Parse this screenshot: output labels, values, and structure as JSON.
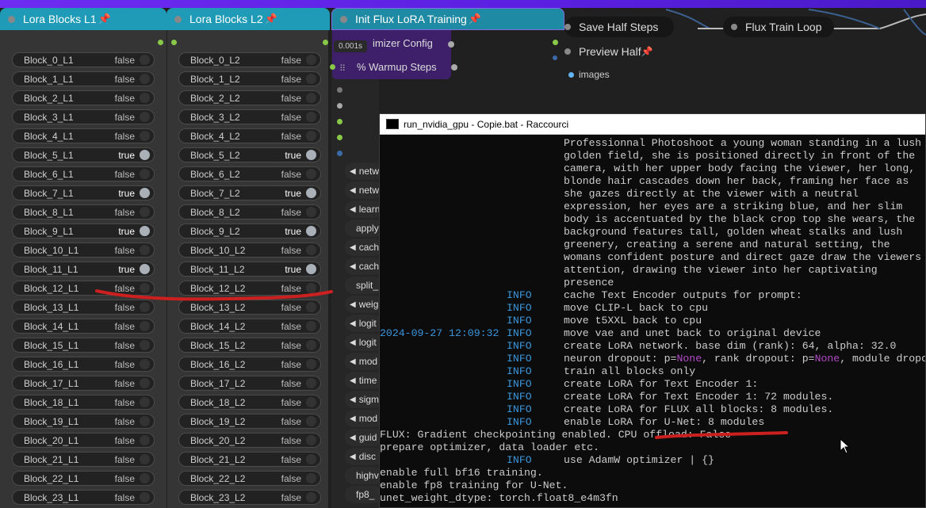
{
  "nodes": {
    "lora_l1": {
      "title": "Lora Blocks L1"
    },
    "lora_l2": {
      "title": "Lora Blocks L2"
    },
    "init_flux": {
      "title": "Init Flux LoRA Training",
      "timing": "0.001s"
    },
    "save_half": {
      "title": "Save Half Steps"
    },
    "flux_loop": {
      "title": "Flux Train Loop"
    },
    "preview_half": {
      "title": "Preview Half"
    },
    "images_output": {
      "label": "images"
    }
  },
  "blocks_l1": [
    {
      "label": "Block_0_L1",
      "value": "false"
    },
    {
      "label": "Block_1_L1",
      "value": "false"
    },
    {
      "label": "Block_2_L1",
      "value": "false"
    },
    {
      "label": "Block_3_L1",
      "value": "false"
    },
    {
      "label": "Block_4_L1",
      "value": "false"
    },
    {
      "label": "Block_5_L1",
      "value": "true"
    },
    {
      "label": "Block_6_L1",
      "value": "false"
    },
    {
      "label": "Block_7_L1",
      "value": "true"
    },
    {
      "label": "Block_8_L1",
      "value": "false"
    },
    {
      "label": "Block_9_L1",
      "value": "true"
    },
    {
      "label": "Block_10_L1",
      "value": "false"
    },
    {
      "label": "Block_11_L1",
      "value": "true"
    },
    {
      "label": "Block_12_L1",
      "value": "false"
    },
    {
      "label": "Block_13_L1",
      "value": "false"
    },
    {
      "label": "Block_14_L1",
      "value": "false"
    },
    {
      "label": "Block_15_L1",
      "value": "false"
    },
    {
      "label": "Block_16_L1",
      "value": "false"
    },
    {
      "label": "Block_17_L1",
      "value": "false"
    },
    {
      "label": "Block_18_L1",
      "value": "false"
    },
    {
      "label": "Block_19_L1",
      "value": "false"
    },
    {
      "label": "Block_20_L1",
      "value": "false"
    },
    {
      "label": "Block_21_L1",
      "value": "false"
    },
    {
      "label": "Block_22_L1",
      "value": "false"
    },
    {
      "label": "Block_23_L1",
      "value": "false"
    }
  ],
  "blocks_l2": [
    {
      "label": "Block_0_L2",
      "value": "false"
    },
    {
      "label": "Block_1_L2",
      "value": "false"
    },
    {
      "label": "Block_2_L2",
      "value": "false"
    },
    {
      "label": "Block_3_L2",
      "value": "false"
    },
    {
      "label": "Block_4_L2",
      "value": "false"
    },
    {
      "label": "Block_5_L2",
      "value": "true"
    },
    {
      "label": "Block_6_L2",
      "value": "false"
    },
    {
      "label": "Block_7_L2",
      "value": "true"
    },
    {
      "label": "Block_8_L2",
      "value": "false"
    },
    {
      "label": "Block_9_L2",
      "value": "true"
    },
    {
      "label": "Block_10_L2",
      "value": "false"
    },
    {
      "label": "Block_11_L2",
      "value": "true"
    },
    {
      "label": "Block_12_L2",
      "value": "false"
    },
    {
      "label": "Block_13_L2",
      "value": "false"
    },
    {
      "label": "Block_14_L2",
      "value": "false"
    },
    {
      "label": "Block_15_L2",
      "value": "false"
    },
    {
      "label": "Block_16_L2",
      "value": "false"
    },
    {
      "label": "Block_17_L2",
      "value": "false"
    },
    {
      "label": "Block_18_L2",
      "value": "false"
    },
    {
      "label": "Block_19_L2",
      "value": "false"
    },
    {
      "label": "Block_20_L2",
      "value": "false"
    },
    {
      "label": "Block_21_L2",
      "value": "false"
    },
    {
      "label": "Block_22_L2",
      "value": "false"
    },
    {
      "label": "Block_23_L2",
      "value": "false"
    }
  ],
  "init_inputs": {
    "optimizer": "imizer Config",
    "warmup": "% Warmup Steps"
  },
  "init_widgets": [
    "netw",
    "netw",
    "learn",
    "apply",
    "cach",
    "cach",
    "split_",
    "weig",
    "logit",
    "logit",
    "mod",
    "time",
    "sigm",
    "mod",
    "guid",
    "disc",
    "highv",
    "fp8_"
  ],
  "terminal": {
    "title": "run_nvidia_gpu - Copie.bat - Raccourci",
    "lines": [
      {
        "ts": "",
        "lvl": "",
        "msg": "Professionnal Photoshoot a young woman standing in a lush"
      },
      {
        "ts": "",
        "lvl": "",
        "msg": "golden field, she is positioned directly in front of the"
      },
      {
        "ts": "",
        "lvl": "",
        "msg": "camera, with her upper body facing the viewer, her long,"
      },
      {
        "ts": "",
        "lvl": "",
        "msg": "blonde hair cascades down her back, framing her face as"
      },
      {
        "ts": "",
        "lvl": "",
        "msg": "she gazes directly at the viewer with a neutral"
      },
      {
        "ts": "",
        "lvl": "",
        "msg": "expression, her eyes are a striking blue, and her slim"
      },
      {
        "ts": "",
        "lvl": "",
        "msg": "body is accentuated by the black crop top she wears, the"
      },
      {
        "ts": "",
        "lvl": "",
        "msg": "background features tall, golden wheat stalks and lush"
      },
      {
        "ts": "",
        "lvl": "",
        "msg": "greenery, creating a serene and natural setting, the"
      },
      {
        "ts": "",
        "lvl": "",
        "msg": "womans confident posture and direct gaze draw the viewers"
      },
      {
        "ts": "",
        "lvl": "",
        "msg": "attention, drawing the viewer into her captivating"
      },
      {
        "ts": "",
        "lvl": "",
        "msg": "presence"
      },
      {
        "ts": "",
        "lvl": "INFO",
        "msg": "cache Text Encoder outputs for prompt:"
      },
      {
        "ts": "",
        "lvl": "INFO",
        "msg": "move CLIP-L back to cpu"
      },
      {
        "ts": "",
        "lvl": "INFO",
        "msg": "move t5XXL back to cpu"
      },
      {
        "ts": "2024-09-27 12:09:32",
        "lvl": "INFO",
        "msg": "move vae and unet back to original device"
      },
      {
        "ts": "",
        "lvl": "INFO",
        "msg": "create LoRA network. base dim (rank): 64, alpha: 32.0"
      },
      {
        "ts": "",
        "lvl": "INFO",
        "msg_parts": [
          "neuron dropout: p=",
          "None",
          ", rank dropout: p=",
          "None",
          ", module dropo"
        ]
      },
      {
        "ts": "",
        "lvl": "INFO",
        "msg": "train all blocks only"
      },
      {
        "ts": "",
        "lvl": "INFO",
        "msg": "create LoRA for Text Encoder 1:"
      },
      {
        "ts": "",
        "lvl": "INFO",
        "msg": "create LoRA for Text Encoder 1: 72 modules."
      },
      {
        "ts": "",
        "lvl": "INFO",
        "msg": "create LoRA for FLUX all blocks: 8 modules."
      },
      {
        "ts": "",
        "lvl": "INFO",
        "msg": "enable LoRA for U-Net: 8 modules"
      },
      {
        "raw": "FLUX: Gradient checkpointing enabled. CPU offload: False"
      },
      {
        "raw": "prepare optimizer, data loader etc."
      },
      {
        "ts": "",
        "lvl": "INFO",
        "msg": "use AdamW optimizer | {}"
      },
      {
        "raw": "enable full bf16 training."
      },
      {
        "raw": "enable fp8 training for U-Net."
      },
      {
        "raw": "unet_weight_dtype: torch.float8_e4m3fn"
      }
    ]
  },
  "colors": {
    "node_header": "#1f9bb7",
    "toggle_on": "#aab0b8",
    "info": "#3a96dd",
    "annotation": "#cc1f1f",
    "slot_green": "#88c94a"
  }
}
